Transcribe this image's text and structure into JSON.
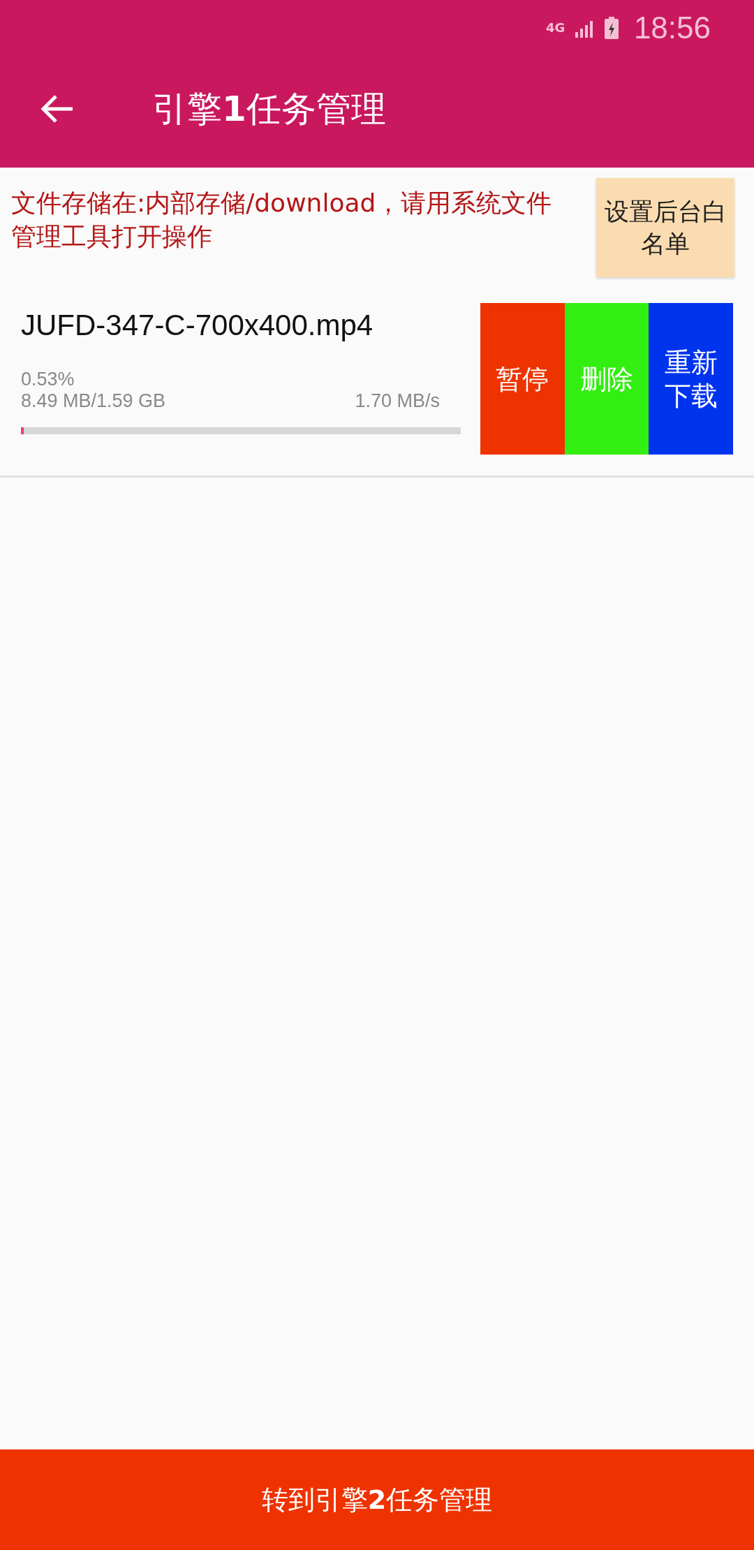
{
  "status_bar": {
    "time": "18:56",
    "network": "4G"
  },
  "app_bar": {
    "title": "引擎**1**任务管理"
  },
  "notice": {
    "text": "文件存储在:内部存储/download，请用系统文件管理工具打开操作",
    "button": "设置后台白名单"
  },
  "tasks": [
    {
      "name": "JUFD-347-C-700x400.mp4",
      "percent": "0.53%",
      "size": "8.49 MB/1.59 GB",
      "speed": "1.70 MB/s",
      "level": 0.0053,
      "actions": [
        {
          "label": "暂停",
          "color": "#ee3300"
        },
        {
          "label": "删除",
          "color": "#33ee11"
        },
        {
          "label": "重新下载",
          "color": "#0033ee"
        }
      ]
    }
  ],
  "bottom_button": "转到引擎**2**任务管理"
}
